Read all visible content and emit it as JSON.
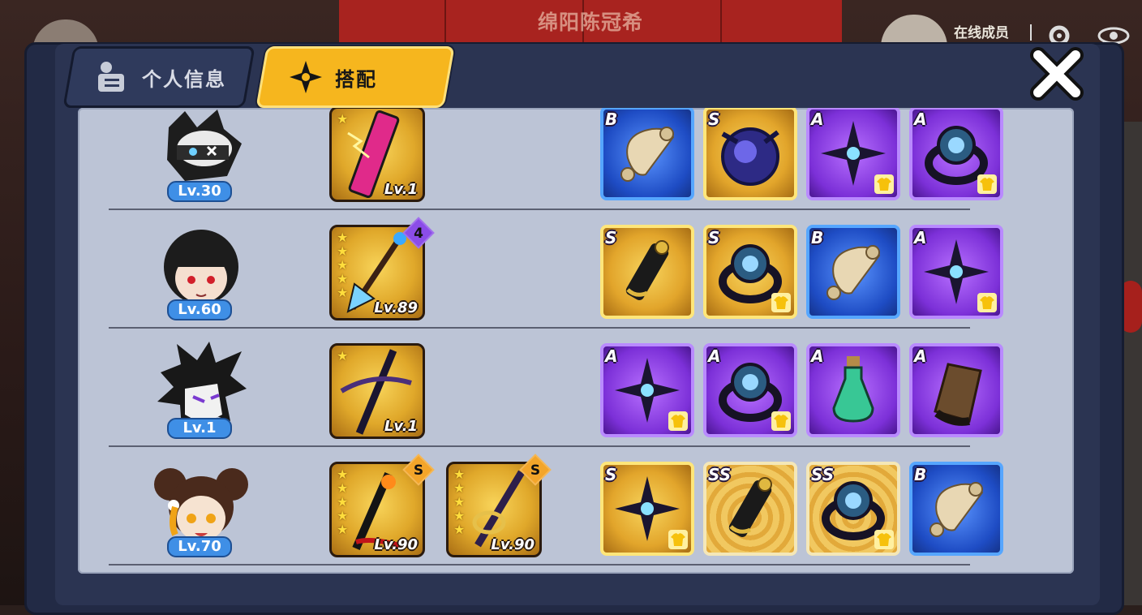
{
  "background": {
    "player_name": "绵阳陈冠希",
    "online_label": "在线成员"
  },
  "tabs": [
    {
      "label": "个人信息",
      "active": false
    },
    {
      "label": "搭配",
      "active": true
    }
  ],
  "colors": {
    "active_tab": "#f6b61e",
    "panel": "#bcc4d6",
    "level_badge": "#3f8fe6",
    "rarity_B": "#1e4cc4",
    "rarity_S": "#e2a52b",
    "rarity_A": "#7c30d8",
    "rarity_SS": "#f1c860"
  },
  "loadouts": [
    {
      "hero_icon": "ninja-cat-masked-head",
      "level": "Lv.30",
      "weapons": [
        {
          "icon": "lightning-phone-weapon-icon",
          "stars": 1,
          "level": "Lv.1",
          "gem": ""
        }
      ],
      "items": [
        {
          "grade": "B",
          "icon": "scroll-icon",
          "shirt": false
        },
        {
          "grade": "S",
          "icon": "dark-orb-icon",
          "shirt": false
        },
        {
          "grade": "A",
          "icon": "shuriken-icon",
          "shirt": true
        },
        {
          "grade": "A",
          "icon": "ring-icon",
          "shirt": true
        }
      ]
    },
    {
      "hero_icon": "black-haired-girl-head",
      "level": "Lv.60",
      "weapons": [
        {
          "icon": "spear-weapon-icon",
          "stars": 5,
          "level": "Lv.89",
          "gem": "4"
        }
      ],
      "items": [
        {
          "grade": "S",
          "icon": "scroll-case-icon",
          "shirt": false
        },
        {
          "grade": "S",
          "icon": "ring-icon",
          "shirt": true
        },
        {
          "grade": "B",
          "icon": "scroll-icon",
          "shirt": false
        },
        {
          "grade": "A",
          "icon": "shuriken-icon",
          "shirt": true
        }
      ]
    },
    {
      "hero_icon": "spiky-hair-masked-head",
      "level": "Lv.1",
      "weapons": [
        {
          "icon": "dark-katana-weapon-icon",
          "stars": 1,
          "level": "Lv.1",
          "gem": ""
        }
      ],
      "items": [
        {
          "grade": "A",
          "icon": "shuriken-icon",
          "shirt": true
        },
        {
          "grade": "A",
          "icon": "ring-icon",
          "shirt": true
        },
        {
          "grade": "A",
          "icon": "potion-icon",
          "shirt": false
        },
        {
          "grade": "A",
          "icon": "gauntlet-icon",
          "shirt": false
        }
      ]
    },
    {
      "hero_icon": "bun-hair-girl-head",
      "level": "Lv.70",
      "weapons": [
        {
          "icon": "flame-scythe-weapon-icon",
          "stars": 5,
          "level": "Lv.90",
          "gem": "S"
        },
        {
          "icon": "katana-weapon-icon",
          "stars": 5,
          "level": "Lv.90",
          "gem": "S"
        }
      ],
      "items": [
        {
          "grade": "S",
          "icon": "shuriken-icon",
          "shirt": true
        },
        {
          "grade": "SS",
          "icon": "scroll-case-icon",
          "shirt": false
        },
        {
          "grade": "SS",
          "icon": "ring-icon",
          "shirt": true
        },
        {
          "grade": "B",
          "icon": "scroll-icon",
          "shirt": false
        }
      ]
    }
  ]
}
